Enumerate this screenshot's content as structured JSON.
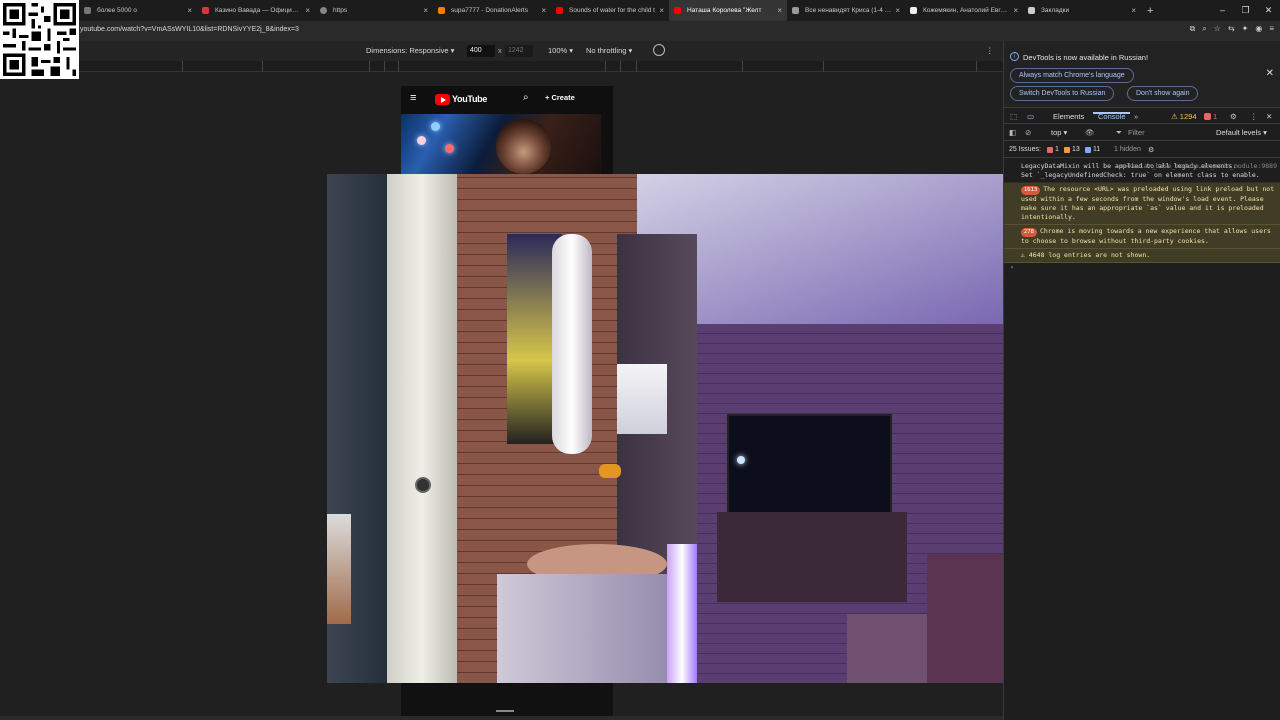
{
  "tabs": [
    {
      "label": "более 5000 о",
      "icon_color": "#777777",
      "close": "×"
    },
    {
      "label": "Казино Вавада — Официальн",
      "icon_color": "#d9363e",
      "close": "×"
    },
    {
      "label": "https",
      "icon_color": "#888888",
      "close": "×"
    },
    {
      "label": "supa7777 - DonationAlerts",
      "icon_color": "#f57d07",
      "close": "×"
    },
    {
      "label": "Sounds of water for the child t",
      "icon_color": "#ff0000",
      "close": "×"
    },
    {
      "label": "Наташа Королева \"Желт",
      "icon_color": "#ff0000",
      "close": "×"
    },
    {
      "label": "Все ненавидят Криса (1-4 сез",
      "icon_color": "#999999",
      "close": "×"
    },
    {
      "label": "Кожемякин, Анатолий Евгень",
      "icon_color": "#eeeeee",
      "close": "×"
    },
    {
      "label": "Закладки",
      "icon_color": "#cccccc",
      "close": "×"
    }
  ],
  "new_tab": "+",
  "window_controls": {
    "minimize": "–",
    "maximize": "❐",
    "close": "✕"
  },
  "address": {
    "url": "youtube.com/watch?v=VmASsWYIL10&list=RDNSivYYE2j_8&index=3"
  },
  "device_toolbar": {
    "dimensions_label": "Dimensions: Responsive ▾",
    "width": "400",
    "times": "x",
    "height": "1242",
    "zoom": "100% ▾",
    "throttling": "No throttling ▾",
    "more": "⋮"
  },
  "youtube": {
    "menu": "≡",
    "brand": "YouTube",
    "search": "⌕",
    "create": "+ Create"
  },
  "devtools": {
    "notice": "DevTools is now available in Russian!",
    "info_icon": "i",
    "close": "✕",
    "btn_match": "Always match Chrome's language",
    "btn_switch": "Switch DevTools to Russian",
    "btn_dont_show": "Don't show again",
    "tab_elements": "Elements",
    "tab_console": "Console",
    "tab_more": "»",
    "warn_count": "⚠ 1294",
    "error_count": "1",
    "gear": "⚙",
    "kebab": "⋮",
    "close_panel": "✕",
    "context": "top ▾",
    "eye": "👁",
    "filter": "Filter",
    "levels": "Default levels ▾",
    "issues_label": "25 Issues:",
    "issues_errors": "1",
    "issues_warnings": "13",
    "issues_info": "11",
    "hidden": "1 hidden",
    "log": {
      "e1_text": "LegacyDataMixin will be applied to all legacy elements.\nSet `_legacyUndefinedCheck: true` on element class to enable.",
      "e1_src": "m=kevlar_base_module…ar_main_module:9889",
      "e2_badge": "1613",
      "e2_text": "The resource <URL> was preloaded using link preload but not used within a few seconds from the window's load event. Please make sure it has an appropriate `as` value and it is preloaded intentionally.",
      "e3_badge": "278",
      "e3_text": "Chrome is moving towards a new experience that allows users to choose to browse without third-party cookies.",
      "e4_text": "⚠ 4648 log entries are not shown.",
      "prompt": "›"
    }
  }
}
